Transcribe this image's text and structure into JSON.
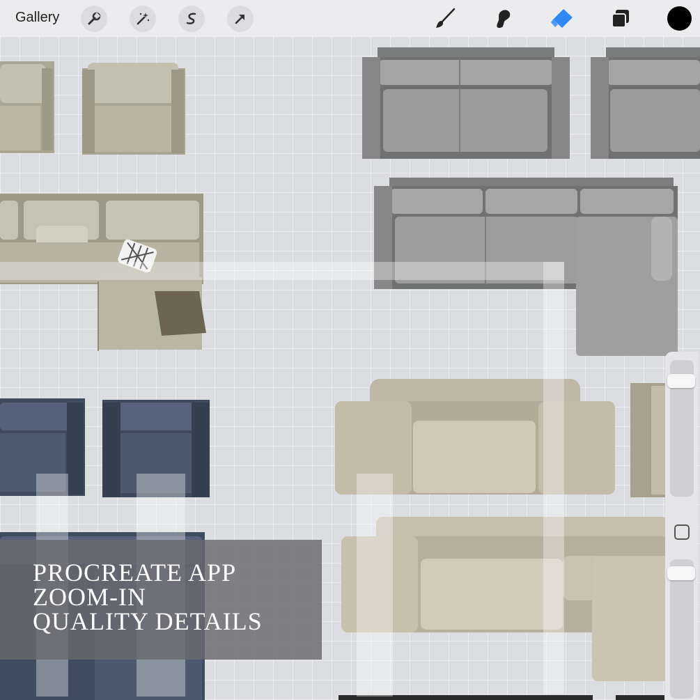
{
  "toolbar": {
    "gallery_label": "Gallery",
    "left_tools": [
      {
        "icon": "wrench-icon",
        "name": "actions"
      },
      {
        "icon": "magic-wand-icon",
        "name": "adjustments"
      },
      {
        "icon": "selection-icon",
        "name": "selection"
      },
      {
        "icon": "arrow-cursor-icon",
        "name": "transform"
      }
    ],
    "right_tools": [
      {
        "icon": "brush-icon",
        "name": "paint"
      },
      {
        "icon": "smudge-icon",
        "name": "smudge"
      },
      {
        "icon": "eraser-icon",
        "name": "erase",
        "active": true
      },
      {
        "icon": "layers-icon",
        "name": "layers"
      }
    ],
    "active_color": "#000000",
    "accent_color": "#2f8af5"
  },
  "caption": {
    "line1": "PROCREATE APP",
    "line2": "ZOOM-IN",
    "line3": "QUALITY DETAILS"
  }
}
